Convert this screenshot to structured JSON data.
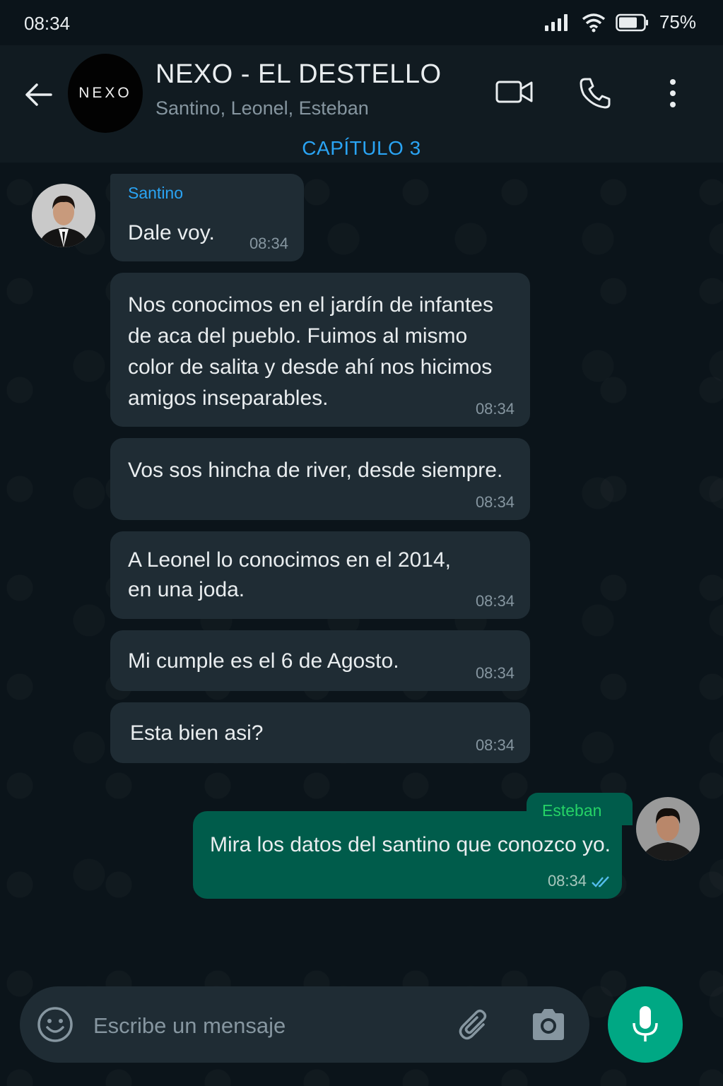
{
  "status": {
    "time": "08:34",
    "battery": "75%"
  },
  "header": {
    "avatar_text": "NEXO",
    "title": "NEXO - EL DESTELLO",
    "members": "Santino, Leonel, Esteban",
    "chapter": "CAPÍTULO 3"
  },
  "messages": [
    {
      "sender": "Santino",
      "text": "Dale voy.",
      "time": "08:34"
    },
    {
      "text": "Nos conocimos en el jardín de infantes de aca del pueblo. Fuimos al mismo color de salita y desde ahí nos hicimos amigos inseparables.",
      "time": "08:34"
    },
    {
      "text": "Vos sos hincha de river, desde siempre.",
      "time": "08:34"
    },
    {
      "text": "A Leonel lo conocimos en el 2014, en una joda.",
      "time": "08:34"
    },
    {
      "text": "Mi cumple es el 6 de Agosto.",
      "time": "08:34"
    },
    {
      "text": "Esta bien asi?",
      "time": "08:34"
    },
    {
      "sender": "Esteban",
      "text": "Mira los datos del santino que conozco yo.",
      "time": "08:34"
    }
  ],
  "input": {
    "placeholder": "Escribe un mensaje"
  },
  "colors": {
    "accent": "#00a884",
    "sender_santino": "#2aa4f4",
    "sender_esteban": "#25d366",
    "outgoing": "#005c4b",
    "incoming": "#1f2c34"
  },
  "icons": [
    "back-arrow-icon",
    "video-call-icon",
    "phone-icon",
    "more-options-icon",
    "emoji-icon",
    "attach-icon",
    "camera-icon",
    "mic-icon",
    "double-check-icon"
  ]
}
